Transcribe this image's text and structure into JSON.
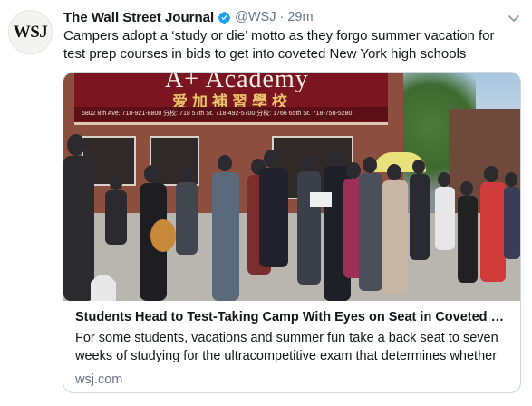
{
  "tweet": {
    "avatar_text": "WSJ",
    "display_name": "The Wall Street Journal",
    "handle": "@WSJ",
    "separator": "·",
    "timestamp": "29m",
    "text": "Campers adopt a ‘study or die’ motto as they forgo summer vacation for test prep courses in bids to get into coveted New York high schools"
  },
  "card": {
    "image": {
      "sign_english": "A+ Academy",
      "sign_chinese": "爱加補習學校",
      "sign_address": "6802 8th Ave. 718-921-8800   分校: 718 57th St. 718-492-5700   分校: 1766 65th St. 718-758-5280"
    },
    "title": "Students Head to Test-Taking Camp With Eyes on Seat in Coveted Ci...",
    "description": "For some students, vacations and summer fun take a back seat to seven weeks of studying for the ultracompetitive exam that determines whether",
    "domain": "wsj.com"
  },
  "colors": {
    "verified": "#1da1f2",
    "secondary_text": "#657786",
    "border": "#ccd6dd"
  },
  "icons": {
    "verified": "verified-badge-icon",
    "caret": "chevron-down-icon"
  }
}
